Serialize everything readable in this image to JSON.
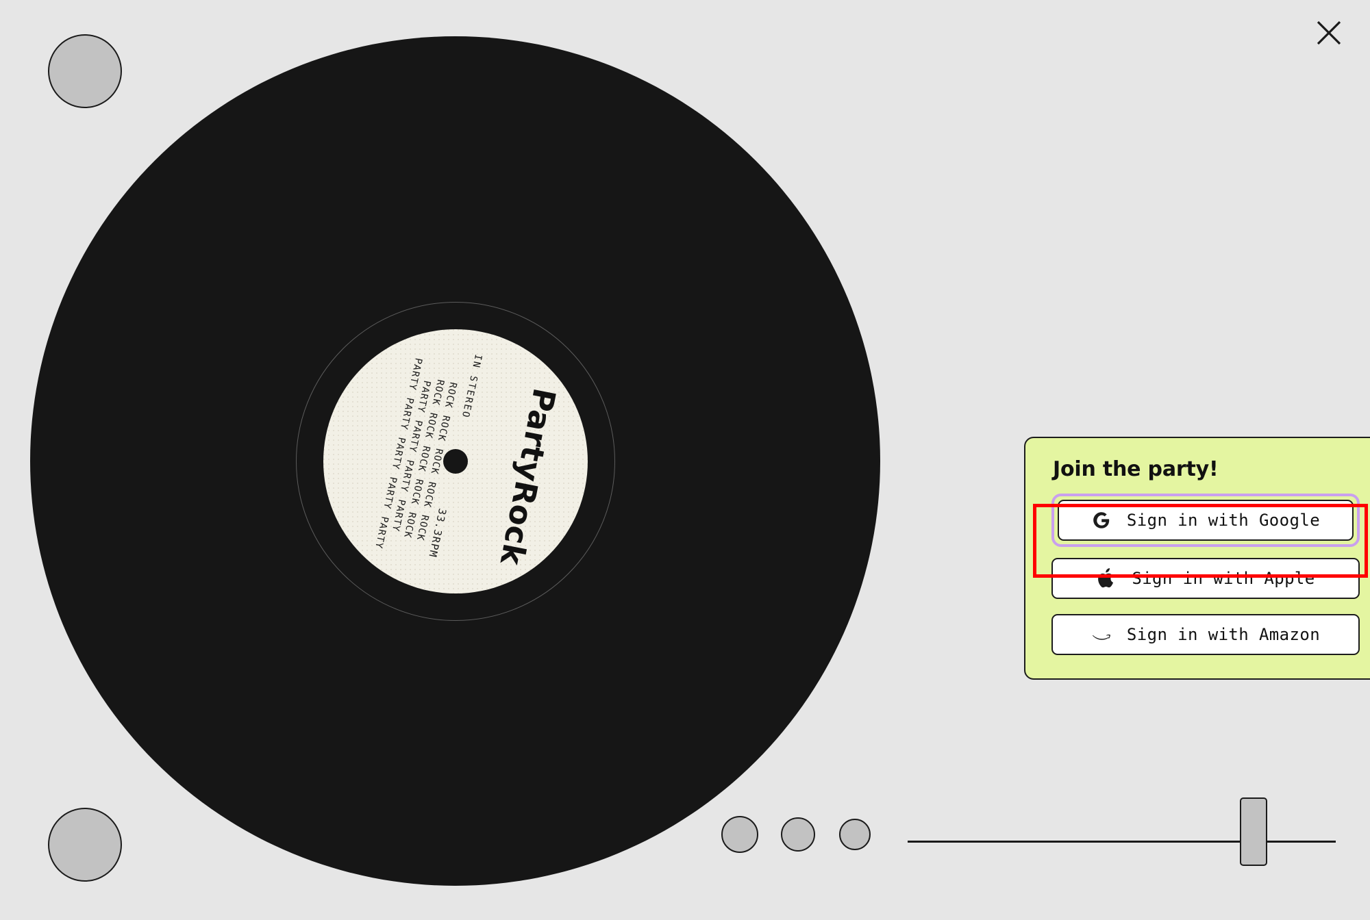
{
  "window": {
    "background_color": "#e6e6e6",
    "close_icon": "close-icon"
  },
  "turntable": {
    "feet": [
      {
        "name": "top-left-foot"
      },
      {
        "name": "bottom-left-foot"
      }
    ],
    "controls": {
      "buttons": [
        {
          "name": "transport-button-1"
        },
        {
          "name": "transport-button-2"
        },
        {
          "name": "transport-button-3"
        }
      ],
      "slider": {
        "name": "pitch-slider",
        "handle_name": "pitch-slider-handle"
      }
    }
  },
  "record": {
    "label": {
      "brand": "PartyRock",
      "stereo_mark": "IN STEREO",
      "speed_mark": "33.3RPM",
      "chant_rows": [
        [
          "ROCK",
          "ROCK",
          "ROCK",
          "ROCK",
          "ROCK"
        ],
        [
          "ROCK",
          "ROCK",
          "ROCK",
          "ROCK",
          "ROCK"
        ],
        [
          "PARTY",
          "PARTY",
          "PARTY",
          "PARTY"
        ],
        [
          "PARTY",
          "PARTY",
          "PARTY",
          "PARTY",
          "PARTY"
        ]
      ],
      "paper_color": "#f2f0e6",
      "vinyl_color": "#161616"
    }
  },
  "signin_panel": {
    "title": "Join the party!",
    "background_color": "#e4f5a1",
    "focus_ring_color": "#c9a0ee",
    "highlight_color": "#ff0000",
    "buttons": [
      {
        "id": "google",
        "label": "Sign in with Google",
        "icon": "google-g-icon",
        "focused": true
      },
      {
        "id": "apple",
        "label": "Sign in with Apple",
        "icon": "apple-logo-icon",
        "focused": false
      },
      {
        "id": "amazon",
        "label": "Sign in with Amazon",
        "icon": "amazon-smile-icon",
        "focused": false
      }
    ]
  }
}
